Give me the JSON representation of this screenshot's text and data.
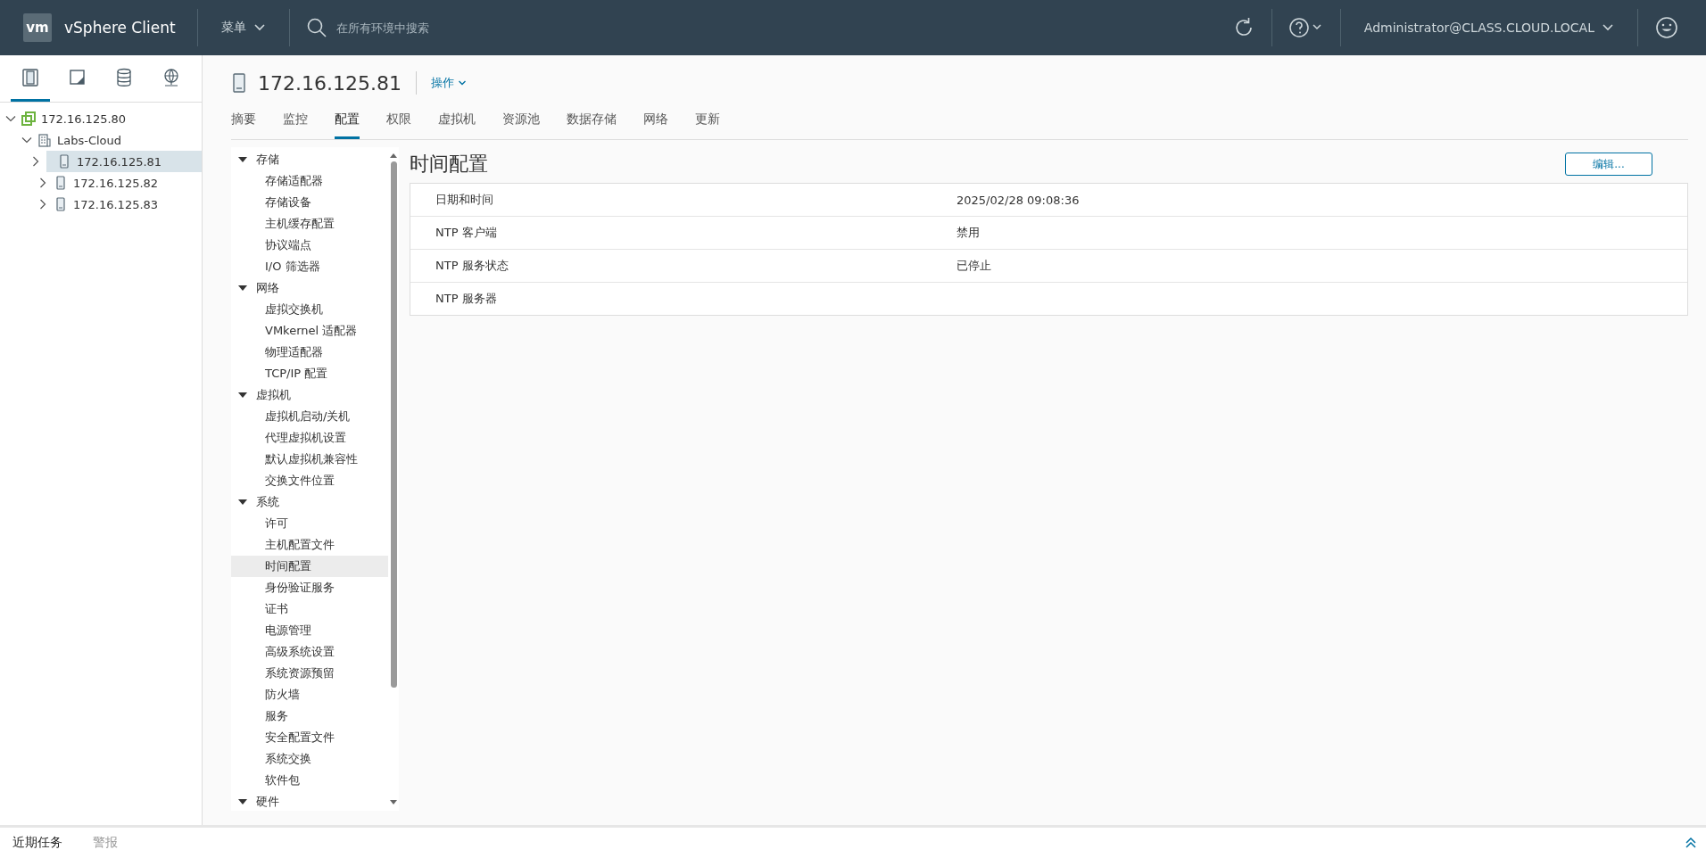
{
  "header": {
    "logo": "vm",
    "app_name": "vSphere Client",
    "menu": "菜单",
    "search": {
      "placeholder": "在所有环境中搜索"
    },
    "user": "Administrator@CLASS.CLOUD.LOCAL"
  },
  "nav_tabs": [
    {
      "kind": "hosts",
      "selected": true
    },
    {
      "kind": "vms",
      "selected": false
    },
    {
      "kind": "storage",
      "selected": false
    },
    {
      "kind": "network",
      "selected": false
    }
  ],
  "inventory": [
    {
      "label": "172.16.125.80",
      "kind": "vcenter",
      "expanded": true,
      "selected": false,
      "children": [
        {
          "label": "Labs-Cloud",
          "kind": "datacenter",
          "expanded": true,
          "selected": false,
          "children": [
            {
              "label": "172.16.125.81",
              "kind": "host",
              "expanded": false,
              "selected": true
            },
            {
              "label": "172.16.125.82",
              "kind": "host",
              "expanded": false,
              "selected": false
            },
            {
              "label": "172.16.125.83",
              "kind": "host",
              "expanded": false,
              "selected": false
            }
          ]
        }
      ]
    }
  ],
  "object": {
    "title": "172.16.125.81",
    "actions": "操作"
  },
  "tabs": [
    {
      "label": "摘要",
      "selected": false
    },
    {
      "label": "监控",
      "selected": false
    },
    {
      "label": "配置",
      "selected": true
    },
    {
      "label": "权限",
      "selected": false
    },
    {
      "label": "虚拟机",
      "selected": false
    },
    {
      "label": "资源池",
      "selected": false
    },
    {
      "label": "数据存储",
      "selected": false
    },
    {
      "label": "网络",
      "selected": false
    },
    {
      "label": "更新",
      "selected": false
    }
  ],
  "config_menu": [
    {
      "label": "存储",
      "expanded": true,
      "children": [
        {
          "label": "存储适配器",
          "selected": false
        },
        {
          "label": "存储设备",
          "selected": false
        },
        {
          "label": "主机缓存配置",
          "selected": false
        },
        {
          "label": "协议端点",
          "selected": false
        },
        {
          "label": "I/O 筛选器",
          "selected": false
        }
      ]
    },
    {
      "label": "网络",
      "expanded": true,
      "children": [
        {
          "label": "虚拟交换机",
          "selected": false
        },
        {
          "label": "VMkernel 适配器",
          "selected": false
        },
        {
          "label": "物理适配器",
          "selected": false
        },
        {
          "label": "TCP/IP 配置",
          "selected": false
        }
      ]
    },
    {
      "label": "虚拟机",
      "expanded": true,
      "children": [
        {
          "label": "虚拟机启动/关机",
          "selected": false
        },
        {
          "label": "代理虚拟机设置",
          "selected": false
        },
        {
          "label": "默认虚拟机兼容性",
          "selected": false
        },
        {
          "label": "交换文件位置",
          "selected": false
        }
      ]
    },
    {
      "label": "系统",
      "expanded": true,
      "children": [
        {
          "label": "许可",
          "selected": false
        },
        {
          "label": "主机配置文件",
          "selected": false
        },
        {
          "label": "时间配置",
          "selected": true
        },
        {
          "label": "身份验证服务",
          "selected": false
        },
        {
          "label": "证书",
          "selected": false
        },
        {
          "label": "电源管理",
          "selected": false
        },
        {
          "label": "高级系统设置",
          "selected": false
        },
        {
          "label": "系统资源预留",
          "selected": false
        },
        {
          "label": "防火墙",
          "selected": false
        },
        {
          "label": "服务",
          "selected": false
        },
        {
          "label": "安全配置文件",
          "selected": false
        },
        {
          "label": "系统交换",
          "selected": false
        },
        {
          "label": "软件包",
          "selected": false
        }
      ]
    },
    {
      "label": "硬件",
      "expanded": true
    }
  ],
  "content": {
    "title": "时间配置",
    "edit_button": "编辑...",
    "rows": [
      {
        "label": "日期和时间",
        "value": "2025/02/28 09:08:36"
      },
      {
        "label": "NTP 客户端",
        "value": "禁用"
      },
      {
        "label": "NTP 服务状态",
        "value": "已停止"
      },
      {
        "label": "NTP 服务器"
      }
    ]
  },
  "bottom_tabs": [
    {
      "label": "近期任务",
      "selected": true
    },
    {
      "label": "警报",
      "selected": false
    }
  ]
}
